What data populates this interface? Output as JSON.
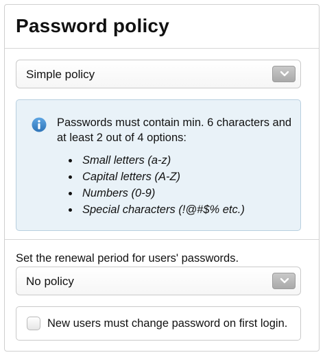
{
  "panel": {
    "title": "Password policy"
  },
  "policy_select": {
    "value": "Simple policy"
  },
  "info": {
    "icon": "info-icon",
    "intro": "Passwords must contain min. 6 characters and at least 2 out of 4 options:",
    "options": [
      "Small letters (a-z)",
      "Capital letters (A-Z)",
      "Numbers (0-9)",
      "Special characters (!@#$% etc.)"
    ]
  },
  "renewal": {
    "label": "Set the renewal period for users' passwords.",
    "value": "No policy"
  },
  "first_login": {
    "label": "New users must change password on first login.",
    "checked": false
  },
  "colors": {
    "info_background": "#e9f2f8",
    "info_icon": "#3f87c7"
  }
}
